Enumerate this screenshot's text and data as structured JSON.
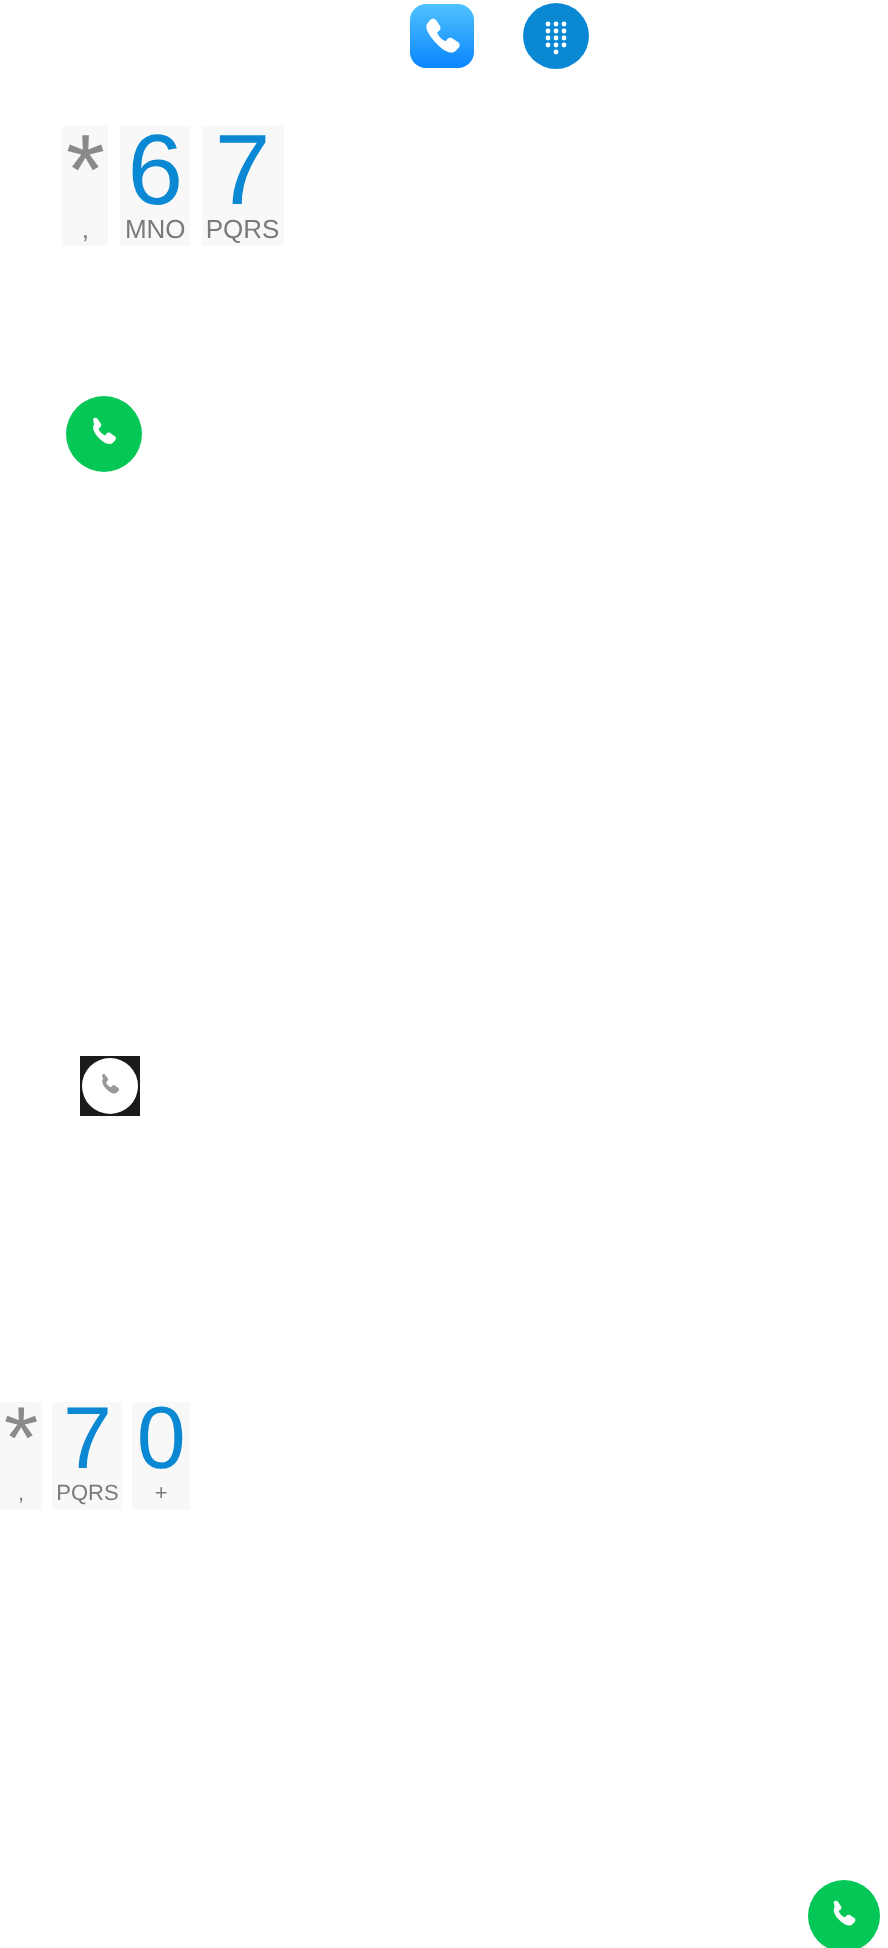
{
  "top_icons": [
    {
      "kind": "phone_app"
    },
    {
      "kind": "dialpad"
    }
  ],
  "key_rows": [
    {
      "keys": [
        {
          "kind": "symbol",
          "main": "*",
          "sub": ","
        },
        {
          "kind": "digit",
          "main": "6",
          "sub": "MNO"
        },
        {
          "kind": "digit",
          "main": "7",
          "sub": "PQRS"
        }
      ]
    },
    {
      "keys": [
        {
          "kind": "symbol",
          "main": "*",
          "sub": ","
        },
        {
          "kind": "digit",
          "main": "7",
          "sub": "PQRS"
        },
        {
          "kind": "digit",
          "main": "0",
          "sub": "+"
        }
      ]
    }
  ]
}
